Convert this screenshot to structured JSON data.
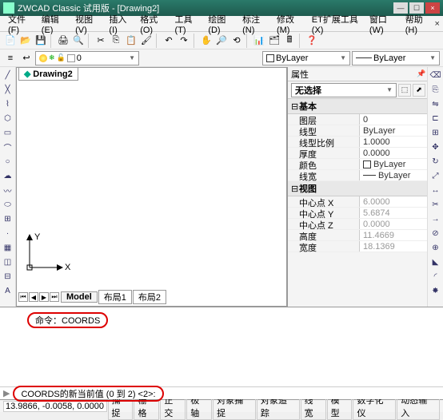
{
  "title": "ZWCAD Classic 试用版 - [Drawing2]",
  "drawing_name": "Drawing2",
  "menus": [
    "文件(F)",
    "编辑(E)",
    "视图(V)",
    "插入(I)",
    "格式(O)",
    "工具(T)",
    "绘图(D)",
    "标注(N)",
    "修改(M)",
    "ET扩展工具(X)",
    "窗口(W)",
    "帮助(H)"
  ],
  "layer_bar": {
    "current_layer": "0",
    "bylayer1": "ByLayer",
    "bylayer2": "ByLayer"
  },
  "model_tabs": {
    "model": "Model",
    "layout1": "布局1",
    "layout2": "布局2"
  },
  "ucs": {
    "x": "X",
    "y": "Y"
  },
  "props": {
    "title": "属性",
    "selection": "无选择",
    "group1": "基本",
    "rows1": [
      {
        "label": "图层",
        "value": "0"
      },
      {
        "label": "线型",
        "value": "ByLayer"
      },
      {
        "label": "线型比例",
        "value": "1.0000"
      },
      {
        "label": "厚度",
        "value": "0.0000"
      },
      {
        "label": "颜色",
        "value": "ByLayer",
        "swatch": "#fff"
      },
      {
        "label": "线宽",
        "value": "ByLayer",
        "line": true
      }
    ],
    "group2": "视图",
    "rows2": [
      {
        "label": "中心点 X",
        "value": "6.0000",
        "dis": true
      },
      {
        "label": "中心点 Y",
        "value": "5.6874",
        "dis": true
      },
      {
        "label": "中心点 Z",
        "value": "0.0000",
        "dis": true
      },
      {
        "label": "高度",
        "value": "11.4669",
        "dis": true
      },
      {
        "label": "宽度",
        "value": "18.1369",
        "dis": true
      }
    ]
  },
  "cmd": {
    "line1": "命令：COORDS",
    "prompt": "COORDS的新当前值 (0 到 2) <2>:"
  },
  "status": {
    "coords": "13.9866, -0.0058, 0.0000",
    "buttons": [
      "捕捉",
      "栅格",
      "正交",
      "极轴",
      "对象捕捉",
      "对象追踪",
      "线宽",
      "模型",
      "数字化仪",
      "动态输入"
    ]
  }
}
